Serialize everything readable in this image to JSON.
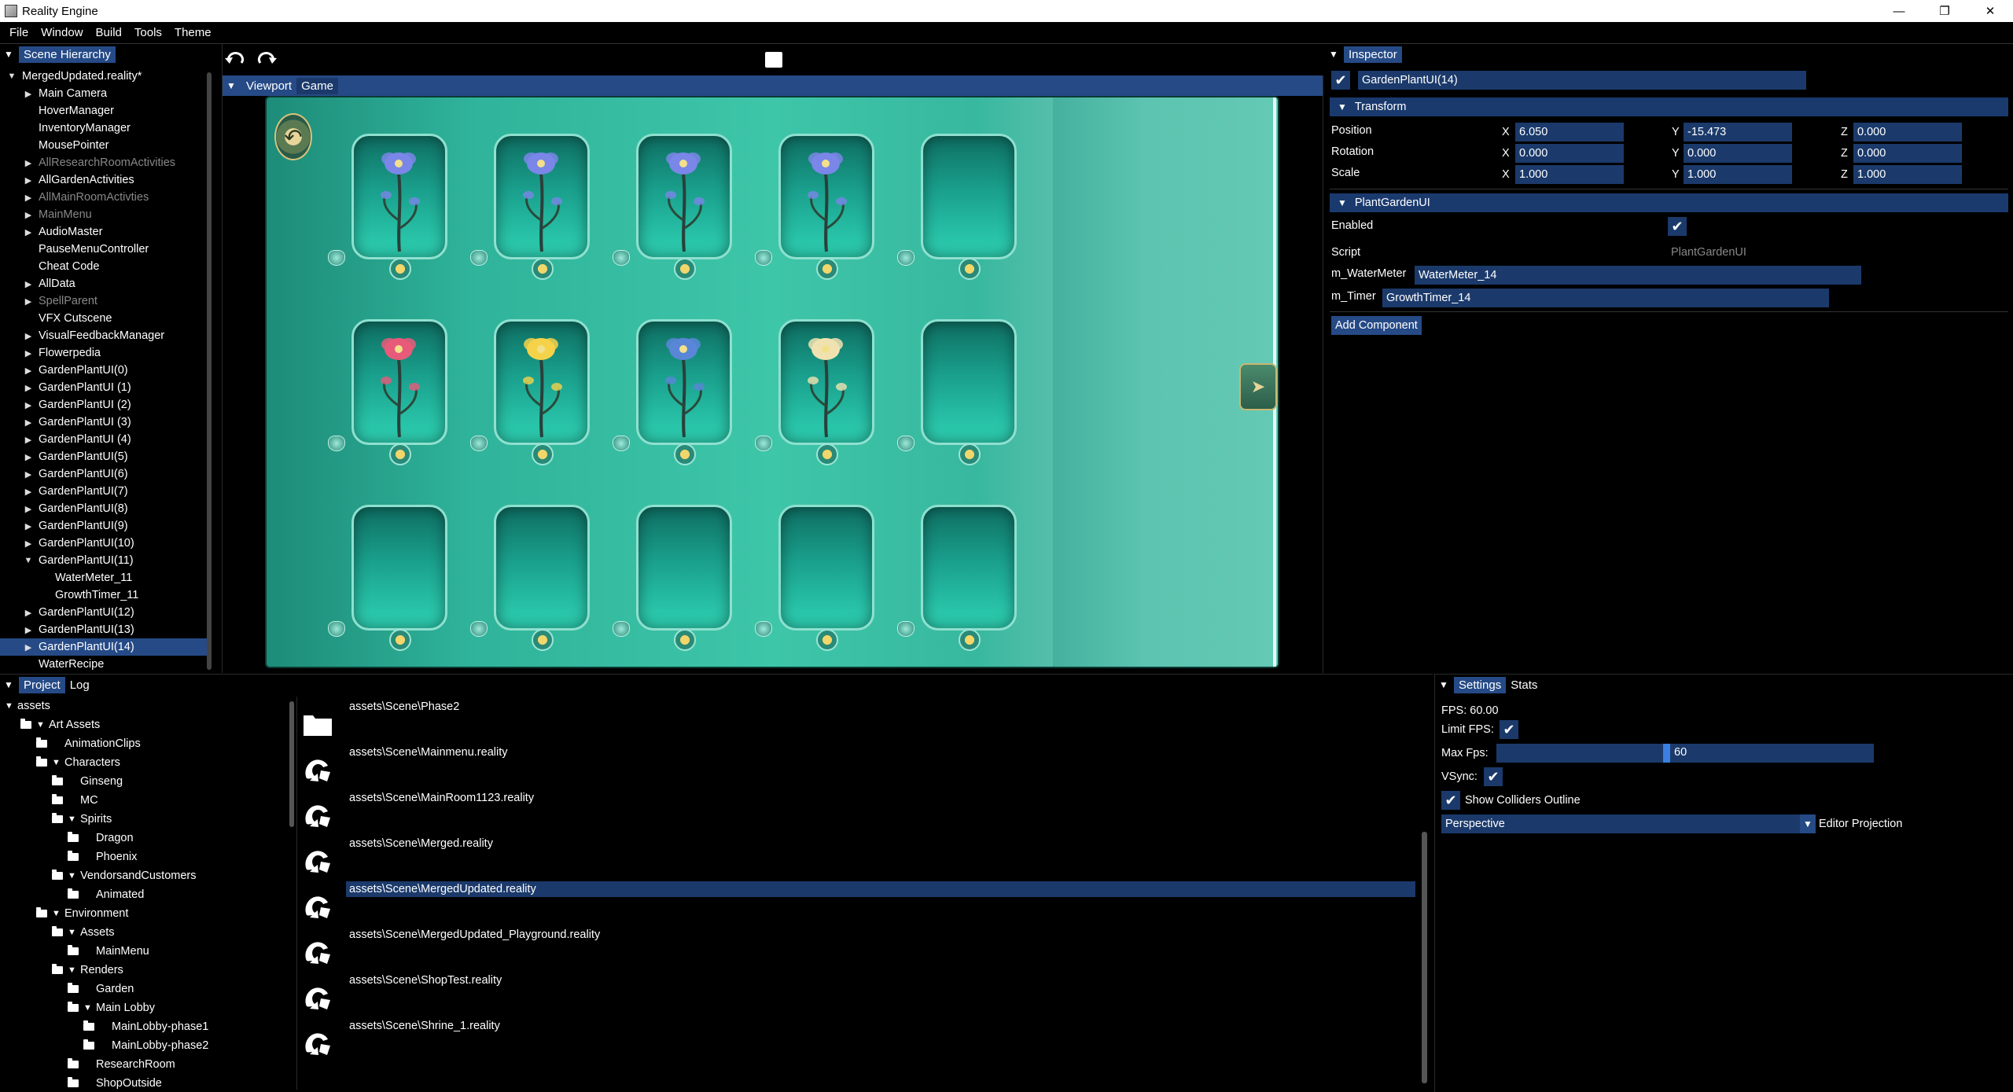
{
  "titlebar": {
    "title": "Reality Engine",
    "minimize": "—",
    "maximize": "❐",
    "close": "✕"
  },
  "menu": [
    "File",
    "Window",
    "Build",
    "Tools",
    "Theme"
  ],
  "hierarchy": {
    "tab": "Scene Hierarchy",
    "items": [
      {
        "label": "MergedUpdated.reality*",
        "indent": 0,
        "arrow": "▼",
        "dim": false
      },
      {
        "label": "Main Camera",
        "indent": 1,
        "arrow": "▶",
        "dim": false
      },
      {
        "label": "HoverManager",
        "indent": 1,
        "arrow": "",
        "dim": false
      },
      {
        "label": "InventoryManager",
        "indent": 1,
        "arrow": "",
        "dim": false
      },
      {
        "label": "MousePointer",
        "indent": 1,
        "arrow": "",
        "dim": false
      },
      {
        "label": "AllResearchRoomActivities",
        "indent": 1,
        "arrow": "▶",
        "dim": true
      },
      {
        "label": "AllGardenActivities",
        "indent": 1,
        "arrow": "▶",
        "dim": false
      },
      {
        "label": "AllMainRoomActivties",
        "indent": 1,
        "arrow": "▶",
        "dim": true
      },
      {
        "label": "MainMenu",
        "indent": 1,
        "arrow": "▶",
        "dim": true
      },
      {
        "label": "AudioMaster",
        "indent": 1,
        "arrow": "▶",
        "dim": false
      },
      {
        "label": "PauseMenuController",
        "indent": 1,
        "arrow": "",
        "dim": false
      },
      {
        "label": "Cheat Code",
        "indent": 1,
        "arrow": "",
        "dim": false
      },
      {
        "label": "AllData",
        "indent": 1,
        "arrow": "▶",
        "dim": false
      },
      {
        "label": "SpellParent",
        "indent": 1,
        "arrow": "▶",
        "dim": true
      },
      {
        "label": "VFX Cutscene",
        "indent": 1,
        "arrow": "",
        "dim": false
      },
      {
        "label": "VisualFeedbackManager",
        "indent": 1,
        "arrow": "▶",
        "dim": false
      },
      {
        "label": "Flowerpedia",
        "indent": 1,
        "arrow": "▶",
        "dim": false
      },
      {
        "label": "GardenPlantUI(0)",
        "indent": 1,
        "arrow": "▶",
        "dim": false
      },
      {
        "label": "GardenPlantUI (1)",
        "indent": 1,
        "arrow": "▶",
        "dim": false
      },
      {
        "label": "GardenPlantUI (2)",
        "indent": 1,
        "arrow": "▶",
        "dim": false
      },
      {
        "label": "GardenPlantUI (3)",
        "indent": 1,
        "arrow": "▶",
        "dim": false
      },
      {
        "label": "GardenPlantUI (4)",
        "indent": 1,
        "arrow": "▶",
        "dim": false
      },
      {
        "label": "GardenPlantUI(5)",
        "indent": 1,
        "arrow": "▶",
        "dim": false
      },
      {
        "label": "GardenPlantUI(6)",
        "indent": 1,
        "arrow": "▶",
        "dim": false
      },
      {
        "label": "GardenPlantUI(7)",
        "indent": 1,
        "arrow": "▶",
        "dim": false
      },
      {
        "label": "GardenPlantUI(8)",
        "indent": 1,
        "arrow": "▶",
        "dim": false
      },
      {
        "label": "GardenPlantUI(9)",
        "indent": 1,
        "arrow": "▶",
        "dim": false
      },
      {
        "label": "GardenPlantUI(10)",
        "indent": 1,
        "arrow": "▶",
        "dim": false
      },
      {
        "label": "GardenPlantUI(11)",
        "indent": 1,
        "arrow": "▼",
        "dim": false
      },
      {
        "label": "WaterMeter_11",
        "indent": 2,
        "arrow": "",
        "dim": false
      },
      {
        "label": "GrowthTimer_11",
        "indent": 2,
        "arrow": "",
        "dim": false
      },
      {
        "label": "GardenPlantUI(12)",
        "indent": 1,
        "arrow": "▶",
        "dim": false
      },
      {
        "label": "GardenPlantUI(13)",
        "indent": 1,
        "arrow": "▶",
        "dim": false
      },
      {
        "label": "GardenPlantUI(14)",
        "indent": 1,
        "arrow": "▶",
        "dim": false,
        "selected": true
      },
      {
        "label": "WaterRecipe",
        "indent": 1,
        "arrow": "",
        "dim": false
      }
    ]
  },
  "toolbar": {
    "undo_icon": "undo-icon",
    "redo_icon": "redo-icon",
    "stop_icon": "stop-icon"
  },
  "viewport": {
    "tabs": [
      "Viewport",
      "Game"
    ]
  },
  "inspector": {
    "tab": "Inspector",
    "object_name": "GardenPlantUI(14)",
    "transform_title": "Transform",
    "position_label": "Position",
    "rotation_label": "Rotation",
    "scale_label": "Scale",
    "axis_x": "X",
    "axis_y": "Y",
    "axis_z": "Z",
    "position": {
      "x": "6.050",
      "y": "-15.473",
      "z": "0.000"
    },
    "rotation": {
      "x": "0.000",
      "y": "0.000",
      "z": "0.000"
    },
    "scale": {
      "x": "1.000",
      "y": "1.000",
      "z": "1.000"
    },
    "component_title": "PlantGardenUI",
    "enabled_label": "Enabled",
    "script_label": "Script",
    "script_value": "PlantGardenUI",
    "water_label": "m_WaterMeter",
    "water_value": "WaterMeter_14",
    "timer_label": "m_Timer",
    "timer_value": "GrowthTimer_14",
    "add_component": "Add Component"
  },
  "project": {
    "tabs": [
      "Project",
      "Log"
    ],
    "tree": [
      {
        "label": "assets",
        "indent": 0,
        "arrow": "▼",
        "folder": false
      },
      {
        "label": "Art Assets",
        "indent": 1,
        "arrow": "▼",
        "folder": true
      },
      {
        "label": "AnimationClips",
        "indent": 2,
        "arrow": "",
        "folder": true
      },
      {
        "label": "Characters",
        "indent": 2,
        "arrow": "▼",
        "folder": true
      },
      {
        "label": "Ginseng",
        "indent": 3,
        "arrow": "",
        "folder": true
      },
      {
        "label": "MC",
        "indent": 3,
        "arrow": "",
        "folder": true
      },
      {
        "label": "Spirits",
        "indent": 3,
        "arrow": "▼",
        "folder": true
      },
      {
        "label": "Dragon",
        "indent": 4,
        "arrow": "",
        "folder": true
      },
      {
        "label": "Phoenix",
        "indent": 4,
        "arrow": "",
        "folder": true
      },
      {
        "label": "VendorsandCustomers",
        "indent": 3,
        "arrow": "▼",
        "folder": true
      },
      {
        "label": "Animated",
        "indent": 4,
        "arrow": "",
        "folder": true
      },
      {
        "label": "Environment",
        "indent": 2,
        "arrow": "▼",
        "folder": true
      },
      {
        "label": "Assets",
        "indent": 3,
        "arrow": "▼",
        "folder": true
      },
      {
        "label": "MainMenu",
        "indent": 4,
        "arrow": "",
        "folder": true
      },
      {
        "label": "Renders",
        "indent": 3,
        "arrow": "▼",
        "folder": true
      },
      {
        "label": "Garden",
        "indent": 4,
        "arrow": "",
        "folder": true
      },
      {
        "label": "Main Lobby",
        "indent": 4,
        "arrow": "▼",
        "folder": true
      },
      {
        "label": "MainLobby-phase1",
        "indent": 5,
        "arrow": "",
        "folder": true
      },
      {
        "label": "MainLobby-phase2",
        "indent": 5,
        "arrow": "",
        "folder": true
      },
      {
        "label": "ResearchRoom",
        "indent": 4,
        "arrow": "",
        "folder": true
      },
      {
        "label": "ShopOutside",
        "indent": 4,
        "arrow": "",
        "folder": true
      }
    ],
    "files": [
      {
        "name": "assets\\Scene\\Phase2",
        "type": "folder"
      },
      {
        "name": "assets\\Scene\\Mainmenu.reality",
        "type": "scene"
      },
      {
        "name": "assets\\Scene\\MainRoom1123.reality",
        "type": "scene"
      },
      {
        "name": "assets\\Scene\\Merged.reality",
        "type": "scene"
      },
      {
        "name": "assets\\Scene\\MergedUpdated.reality",
        "type": "scene",
        "selected": true
      },
      {
        "name": "assets\\Scene\\MergedUpdated_Playground.reality",
        "type": "scene"
      },
      {
        "name": "assets\\Scene\\ShopTest.reality",
        "type": "scene"
      },
      {
        "name": "assets\\Scene\\Shrine_1.reality",
        "type": "scene"
      }
    ]
  },
  "settings": {
    "tabs": [
      "Settings",
      "Stats"
    ],
    "fps": "FPS: 60.00",
    "limit_fps_label": "Limit FPS:",
    "max_fps_label": "Max Fps:",
    "max_fps_value": "60",
    "max_fps_fraction": 0.45,
    "vsync_label": "VSync:",
    "show_colliders_label": "Show Colliders Outline",
    "projection_value": "Perspective",
    "projection_label": "Editor Projection"
  },
  "colors": {
    "accent": "#254a86",
    "field": "#1b3a6b",
    "bg": "#000000"
  }
}
